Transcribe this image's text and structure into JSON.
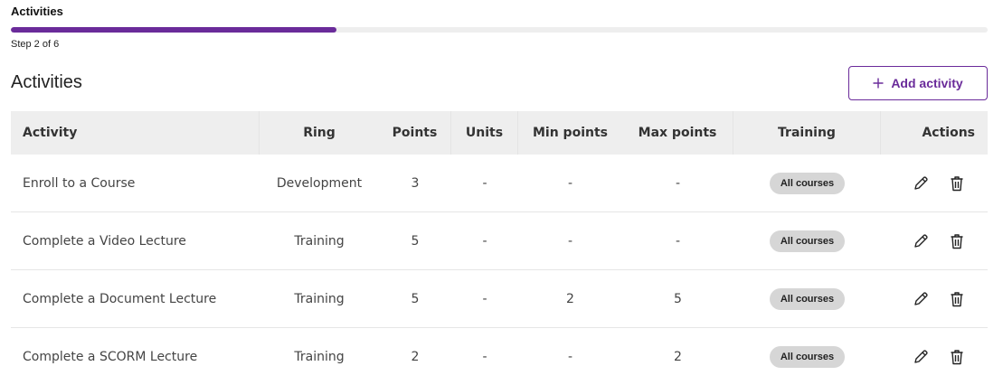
{
  "stepper": {
    "title": "Activities",
    "step_label": "Step 2 of 6",
    "progress": 0.333,
    "accent": "#6a2b9a"
  },
  "section": {
    "title": "Activities",
    "add_button_label": "Add activity",
    "add_icon": "plus-icon"
  },
  "table": {
    "headers": {
      "activity": "Activity",
      "ring": "Ring",
      "points": "Points",
      "units": "Units",
      "min_points": "Min points",
      "max_points": "Max points",
      "training": "Training",
      "actions": "Actions"
    },
    "rows": [
      {
        "activity": "Enroll to a Course",
        "ring": "Development",
        "points": "3",
        "units": "-",
        "min_points": "-",
        "max_points": "-",
        "training": "All courses"
      },
      {
        "activity": "Complete a Video Lecture",
        "ring": "Training",
        "points": "5",
        "units": "-",
        "min_points": "-",
        "max_points": "-",
        "training": "All courses"
      },
      {
        "activity": "Complete a Document Lecture",
        "ring": "Training",
        "points": "5",
        "units": "-",
        "min_points": "2",
        "max_points": "5",
        "training": "All courses"
      },
      {
        "activity": "Complete a SCORM Lecture",
        "ring": "Training",
        "points": "2",
        "units": "-",
        "min_points": "-",
        "max_points": "2",
        "training": "All courses"
      }
    ],
    "row_action_icons": [
      "pencil-icon",
      "trash-icon"
    ]
  }
}
